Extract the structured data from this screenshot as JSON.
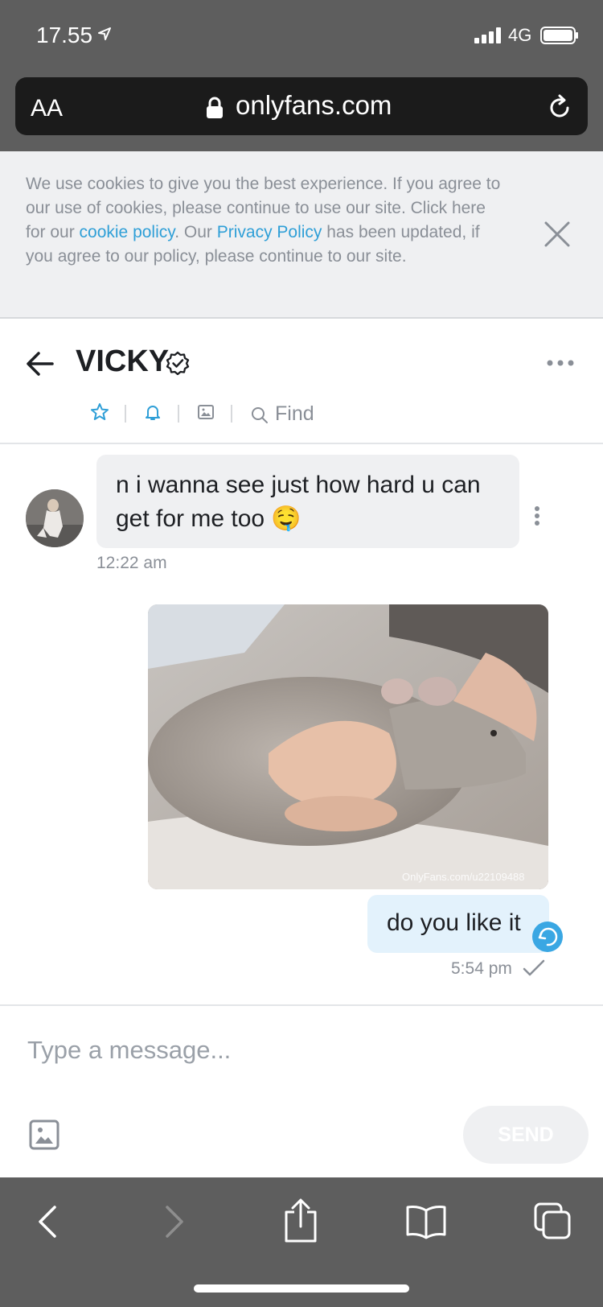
{
  "status": {
    "time": "17.55",
    "network": "4G"
  },
  "browser": {
    "text_size_label": "AA",
    "url": "onlyfans.com"
  },
  "cookie": {
    "text_before": "We use cookies to give you the best experience. If you agree to our use of cookies, please continue to use our site. Click here for our ",
    "cookie_link": "cookie policy",
    "text_mid": ". Our ",
    "privacy_link": "Privacy Policy",
    "text_after": " has been updated, if you agree to our policy, please continue to our site."
  },
  "chat": {
    "contact_name": "VICKY",
    "find_label": "Find",
    "messages": [
      {
        "text": "n i wanna see just how hard u can get for me too 🤤",
        "time": "12:22 am"
      },
      {
        "text": "do you like it",
        "time": "5:54 pm"
      }
    ],
    "photo_watermark": "OnlyFans.com/u22109488"
  },
  "compose": {
    "placeholder": "Type a message...",
    "send_label": "SEND"
  },
  "colors": {
    "accent": "#2f9fd7",
    "chrome": "#5e5e5e",
    "bubble_in": "#eff0f2",
    "bubble_out": "#e3f2fc"
  }
}
